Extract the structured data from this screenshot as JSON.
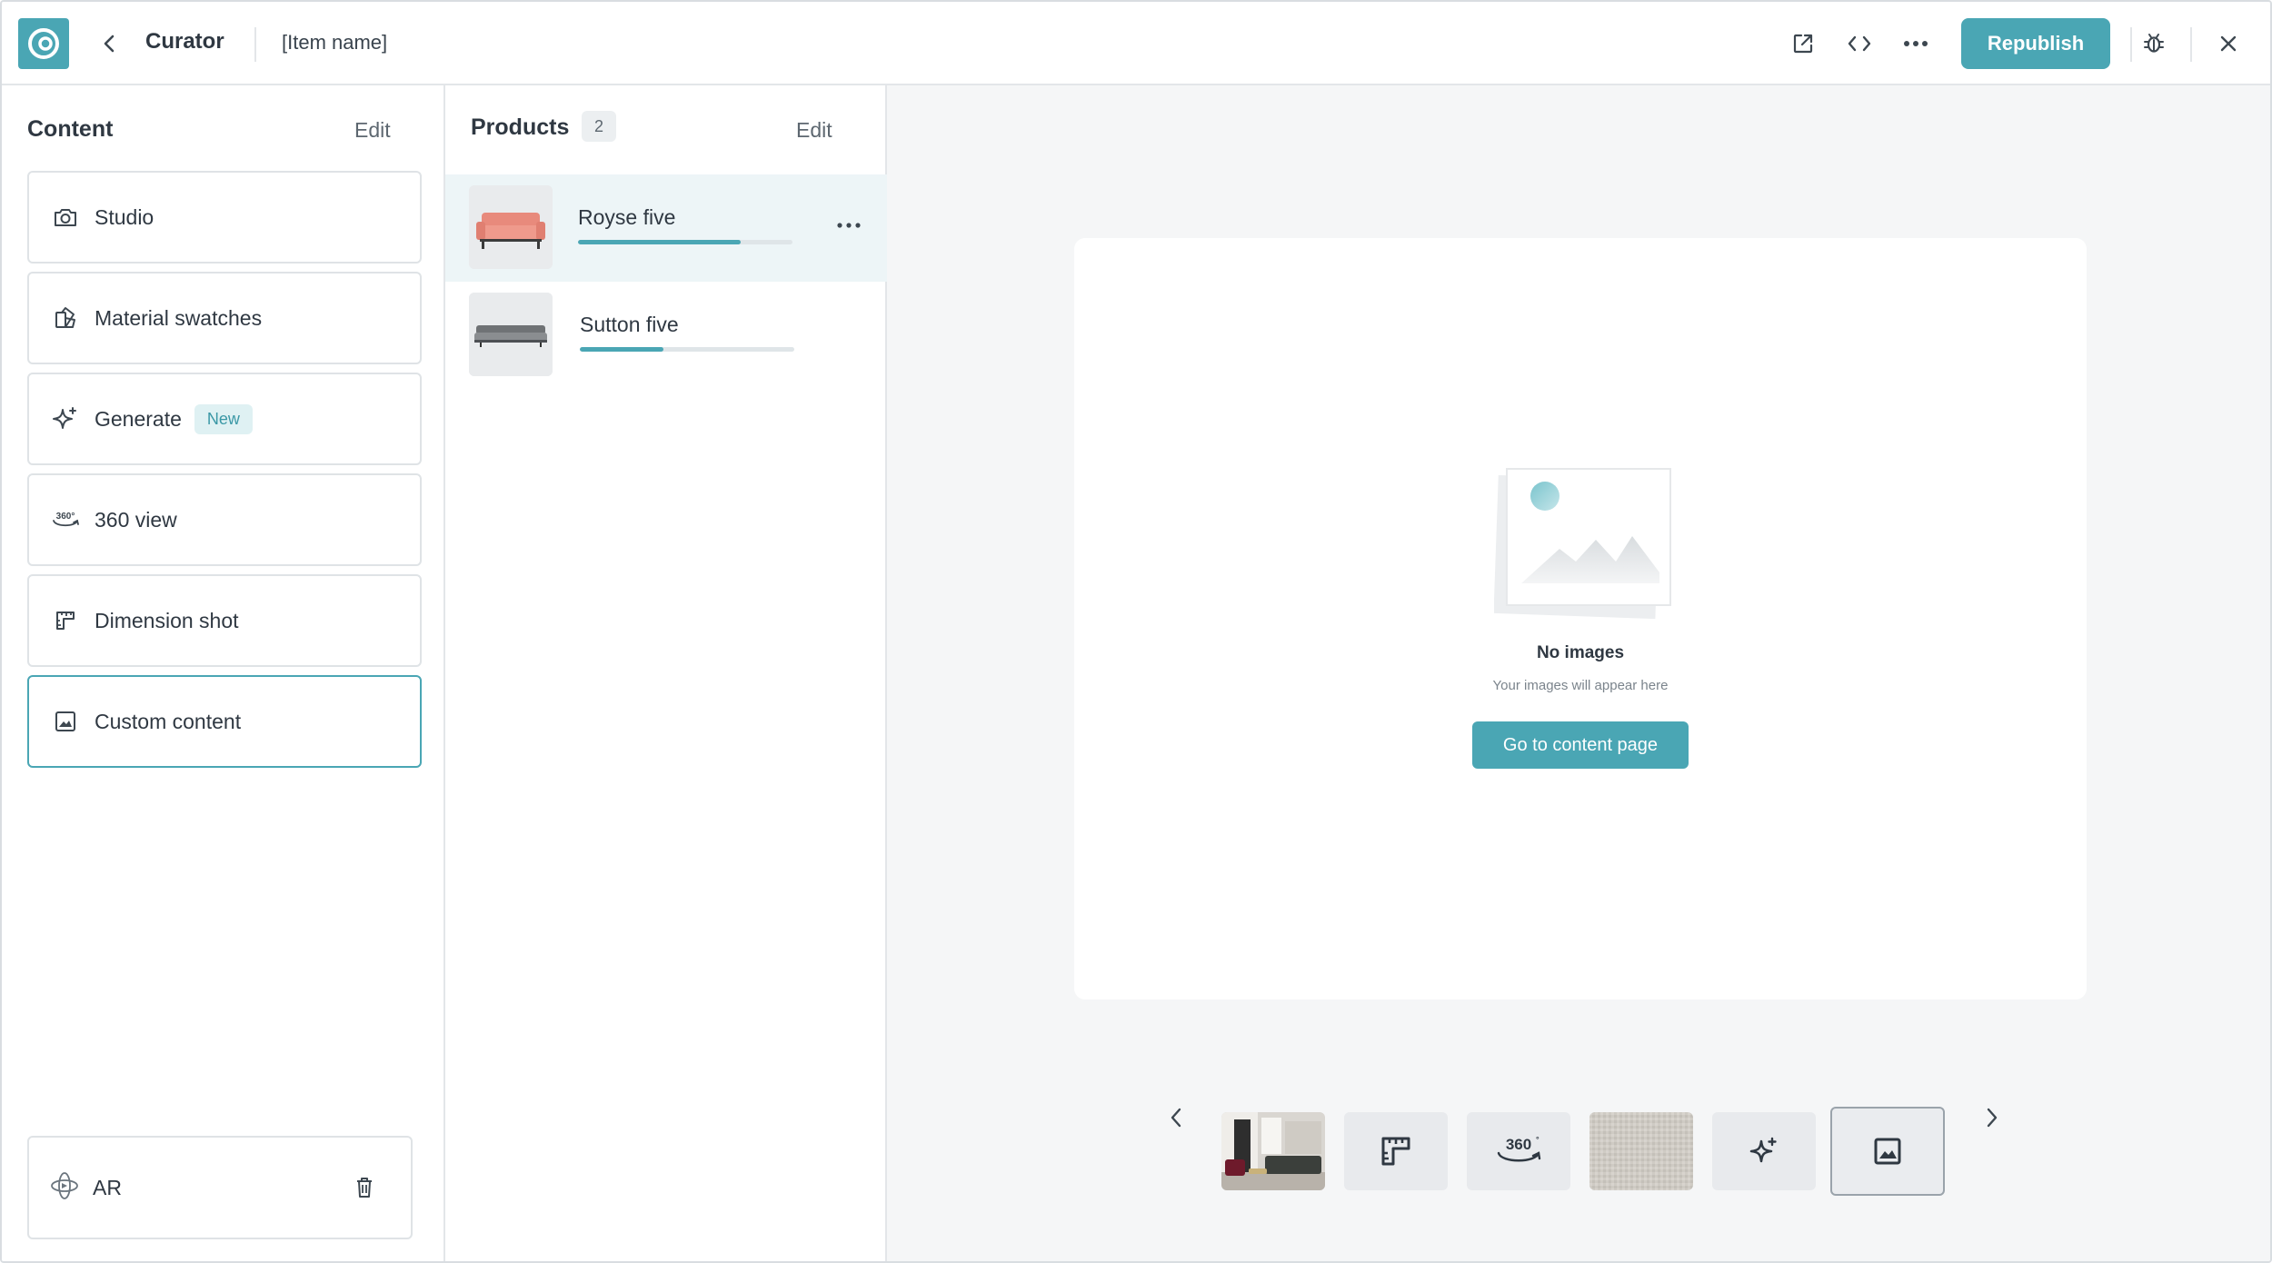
{
  "header": {
    "app_title": "Curator",
    "item_name": "[Item name]",
    "republish_label": "Republish"
  },
  "content_sidebar": {
    "title": "Content",
    "edit_label": "Edit",
    "items": [
      {
        "label": "Studio",
        "icon": "camera-icon"
      },
      {
        "label": "Material swatches",
        "icon": "swatch-icon"
      },
      {
        "label": "Generate",
        "icon": "sparkle-icon",
        "badge": "New"
      },
      {
        "label": "360 view",
        "icon": "360-icon"
      },
      {
        "label": "Dimension shot",
        "icon": "ruler-icon"
      },
      {
        "label": "Custom content",
        "icon": "image-icon",
        "selected": true
      }
    ],
    "ar": {
      "label": "AR",
      "icon": "ar-icon"
    }
  },
  "products": {
    "title": "Products",
    "count": "2",
    "edit_label": "Edit",
    "items": [
      {
        "name": "Royse five",
        "progress": 0.76,
        "active": true
      },
      {
        "name": "Sutton five",
        "progress": 0.39,
        "active": false
      }
    ]
  },
  "preview": {
    "empty_title": "No images",
    "empty_subtitle": "Your images will appear here",
    "cta_label": "Go to content page",
    "thumbnails": [
      {
        "kind": "room-photo"
      },
      {
        "kind": "dimension-icon"
      },
      {
        "kind": "360-icon",
        "label": "360"
      },
      {
        "kind": "fabric-swatch"
      },
      {
        "kind": "sparkle-icon"
      },
      {
        "kind": "image-icon",
        "selected": true
      }
    ]
  },
  "colors": {
    "accent": "#4aa6b4",
    "accent_light": "#dff1f3",
    "border": "#dfe3e6",
    "active_row": "#edf5f7"
  }
}
